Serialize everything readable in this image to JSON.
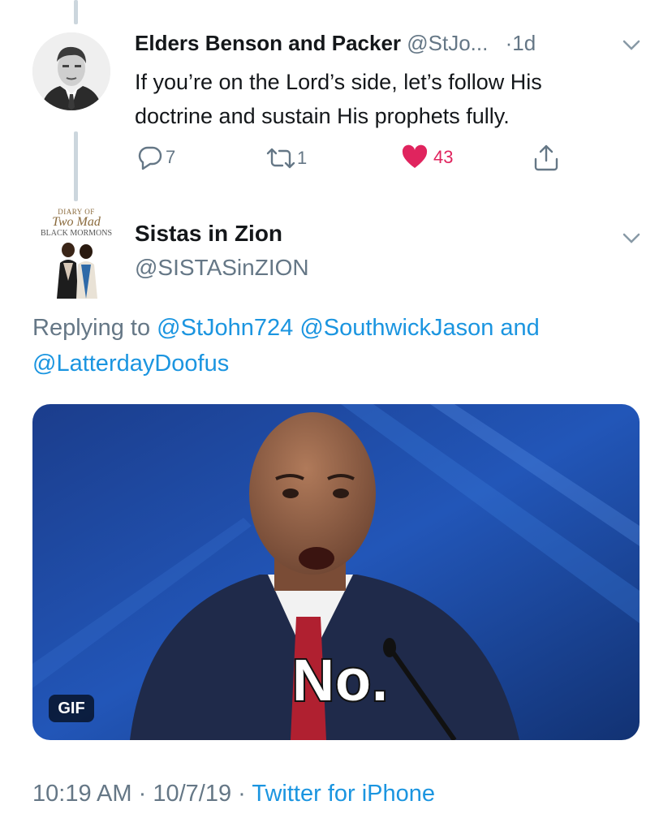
{
  "original_tweet": {
    "author_name": "Elders Benson and Packer",
    "handle": "@StJo...",
    "time": "·1d",
    "text_line1": "If you’re on the Lord’s side, let’s follow His",
    "text_line2": "doctrine and sustain His prophets fully.",
    "reply_count": "7",
    "retweet_count": "1",
    "like_count": "43",
    "liked_color": "#e0245e"
  },
  "reply_tweet": {
    "logo_line1": "DIARY OF",
    "logo_line2": "Two Mad",
    "logo_line3": "BLACK MORMONS",
    "author_name": "Sistas in Zion",
    "handle": "@SISTASinZION",
    "replying_prefix": "Replying to",
    "mention1": "@StJohn724",
    "mention2": "@SouthwickJason",
    "and_word": "and",
    "mention3": "@LatterdayDoofus",
    "gif_caption": "No.",
    "gif_badge": "GIF",
    "footer_time": "10:19 AM",
    "footer_sep1": "·",
    "footer_date": "10/7/19",
    "footer_sep2": "·",
    "footer_source": "Twitter for iPhone"
  },
  "colors": {
    "accent": "#1b95e0",
    "muted": "#657786",
    "thread_line": "#ccd6dd"
  }
}
